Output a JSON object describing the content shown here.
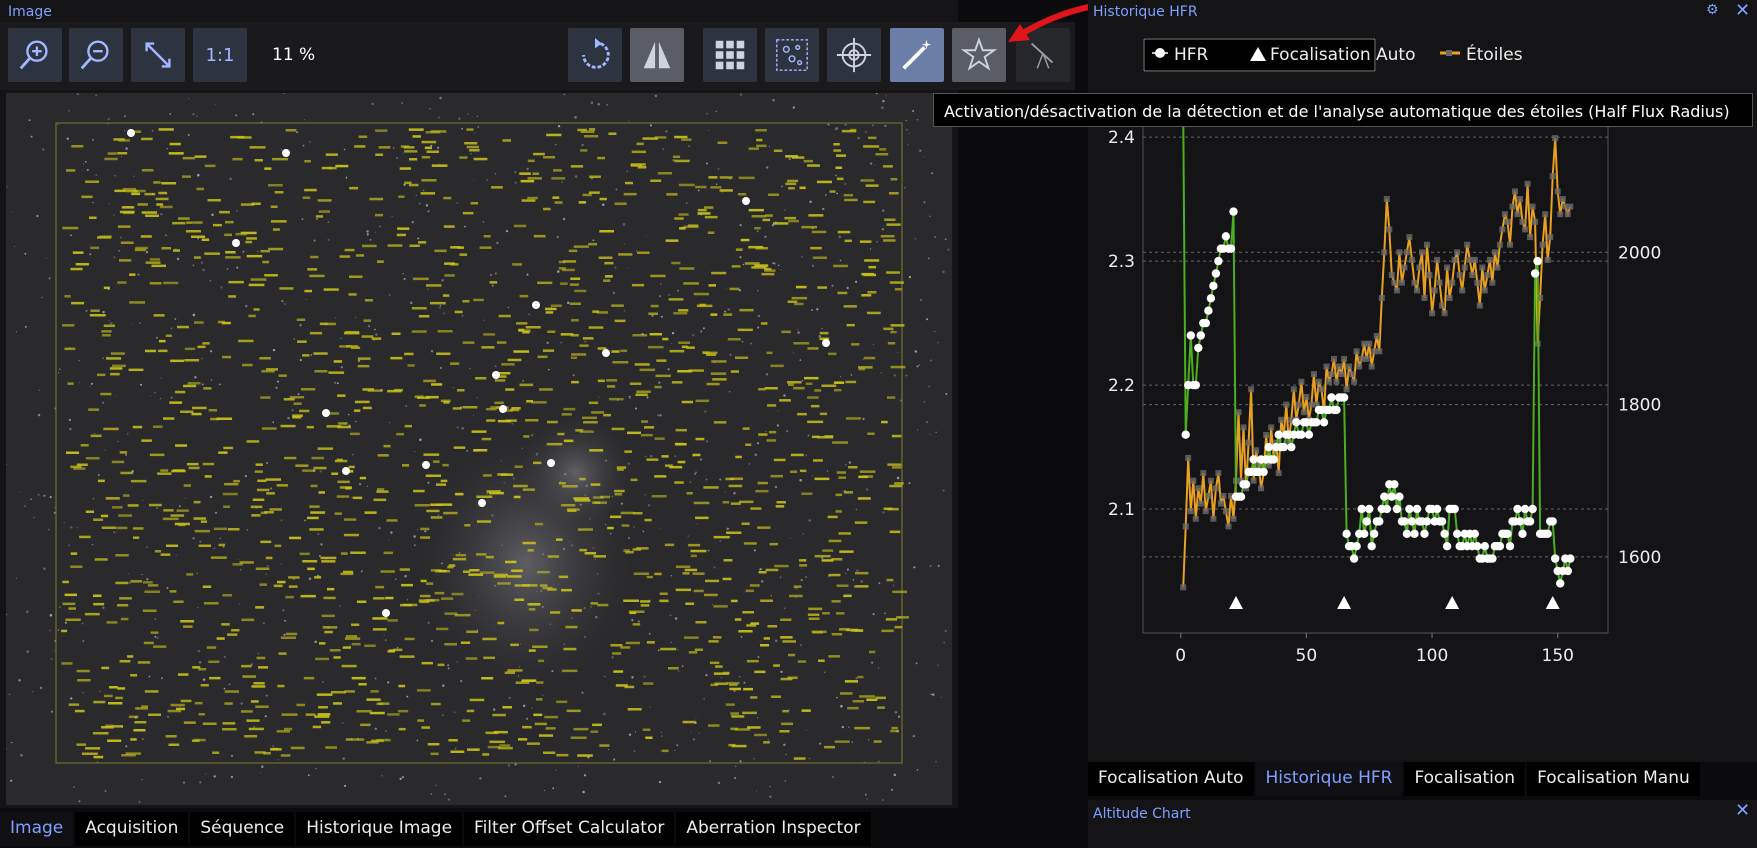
{
  "image_panel": {
    "title": "Image",
    "zoom_label": "11 %",
    "one_to_one_label": "1:1",
    "toolbar_icons": [
      "zoom-in-icon",
      "zoom-out-icon",
      "fit-icon",
      "one-to-one",
      "rotate-icon",
      "flip-icon",
      "grid-icon",
      "stars-icon",
      "crosshair-icon",
      "magic-wand-icon",
      "star-icon",
      "telescope-icon"
    ]
  },
  "tooltip": "Activation/désactivation de la détection et de l'analyse automatique des étoiles (Half Flux Radius)",
  "left_tabs": [
    "Image",
    "Acquisition",
    "Séquence",
    "Historique Image",
    "Filter Offset Calculator",
    "Aberration Inspector"
  ],
  "hfr_panel": {
    "title": "Historique HFR",
    "legend": [
      "HFR",
      "Focalisation Auto",
      "Étoiles"
    ]
  },
  "right_tabs": [
    "Focalisation Auto",
    "Historique HFR",
    "Focalisation",
    "Focalisation Manu"
  ],
  "altitude_panel": {
    "title": "Altitude Chart"
  },
  "colors": {
    "accent": "#7fa0ff",
    "hfr_line": "#4caf1e",
    "stars_line": "#e8a020",
    "hfr_point": "#ffffff"
  },
  "chart_data": {
    "type": "line",
    "xlim": [
      -15,
      170
    ],
    "x_ticks": [
      0,
      50,
      100,
      150
    ],
    "y_left_lim": [
      2.0,
      2.43
    ],
    "y_left_ticks": [
      "2.1",
      "2.2",
      "2.3",
      "2.4"
    ],
    "y_right_lim": [
      1500,
      2200
    ],
    "y_right_ticks": [
      "1600",
      "1800",
      "2000"
    ],
    "series": [
      {
        "name": "HFR",
        "axis": "left",
        "x": [
          1,
          2,
          3,
          4,
          5,
          6,
          7,
          8,
          9,
          10,
          11,
          12,
          13,
          14,
          15,
          16,
          17,
          18,
          19,
          20,
          21,
          22,
          23,
          24,
          25,
          26,
          27,
          28,
          29,
          30,
          31,
          32,
          33,
          34,
          35,
          36,
          37,
          38,
          39,
          40,
          41,
          42,
          43,
          44,
          45,
          46,
          47,
          48,
          49,
          50,
          51,
          52,
          53,
          54,
          55,
          56,
          57,
          58,
          59,
          60,
          61,
          62,
          63,
          64,
          65,
          66,
          67,
          68,
          69,
          70,
          71,
          72,
          73,
          74,
          75,
          76,
          77,
          78,
          79,
          80,
          81,
          82,
          83,
          84,
          85,
          86,
          87,
          88,
          89,
          90,
          91,
          92,
          93,
          94,
          95,
          96,
          97,
          98,
          99,
          100,
          101,
          102,
          103,
          104,
          105,
          106,
          107,
          108,
          109,
          110,
          111,
          112,
          113,
          114,
          115,
          116,
          117,
          118,
          119,
          120,
          121,
          122,
          123,
          124,
          125,
          126,
          127,
          128,
          129,
          130,
          131,
          132,
          133,
          134,
          135,
          136,
          137,
          138,
          139,
          140,
          141,
          142,
          143,
          144,
          145,
          146,
          147,
          148,
          149,
          150,
          151,
          152,
          153,
          154,
          155
        ],
        "values": [
          2.42,
          2.16,
          2.2,
          2.24,
          2.2,
          2.2,
          2.23,
          2.24,
          2.25,
          2.25,
          2.26,
          2.27,
          2.28,
          2.29,
          2.3,
          2.31,
          2.31,
          2.32,
          2.31,
          2.31,
          2.34,
          2.11,
          2.11,
          2.11,
          2.12,
          2.12,
          2.13,
          2.13,
          2.14,
          2.13,
          2.13,
          2.14,
          2.13,
          2.14,
          2.15,
          2.14,
          2.14,
          2.15,
          2.16,
          2.15,
          2.15,
          2.16,
          2.16,
          2.15,
          2.16,
          2.17,
          2.16,
          2.16,
          2.17,
          2.17,
          2.16,
          2.17,
          2.17,
          2.17,
          2.18,
          2.18,
          2.17,
          2.18,
          2.18,
          2.19,
          2.18,
          2.18,
          2.19,
          2.19,
          2.19,
          2.08,
          2.07,
          2.07,
          2.06,
          2.07,
          2.08,
          2.1,
          2.08,
          2.09,
          2.1,
          2.07,
          2.08,
          2.09,
          2.09,
          2.1,
          2.11,
          2.1,
          2.12,
          2.11,
          2.12,
          2.1,
          2.11,
          2.09,
          2.09,
          2.08,
          2.1,
          2.09,
          2.08,
          2.1,
          2.09,
          2.09,
          2.08,
          2.09,
          2.1,
          2.1,
          2.09,
          2.1,
          2.09,
          2.09,
          2.08,
          2.07,
          2.1,
          2.1,
          2.1,
          2.08,
          2.07,
          2.07,
          2.08,
          2.07,
          2.08,
          2.07,
          2.08,
          2.07,
          2.06,
          2.06,
          2.07,
          2.06,
          2.06,
          2.06,
          2.07,
          2.07,
          2.07,
          2.08,
          2.08,
          2.08,
          2.07,
          2.09,
          2.09,
          2.1,
          2.09,
          2.08,
          2.1,
          2.09,
          2.09,
          2.1,
          2.29,
          2.3,
          2.08,
          2.08,
          2.08,
          2.08,
          2.09,
          2.09,
          2.06,
          2.05,
          2.04,
          2.05,
          2.06,
          2.05,
          2.06
        ]
      },
      {
        "name": "Étoiles",
        "axis": "right",
        "x": [
          1,
          2,
          3,
          4,
          5,
          6,
          7,
          8,
          9,
          10,
          11,
          12,
          13,
          14,
          15,
          16,
          17,
          18,
          19,
          20,
          21,
          22,
          23,
          24,
          25,
          26,
          27,
          28,
          29,
          30,
          31,
          32,
          33,
          34,
          35,
          36,
          37,
          38,
          39,
          40,
          41,
          42,
          43,
          44,
          45,
          46,
          47,
          48,
          49,
          50,
          51,
          52,
          53,
          54,
          55,
          56,
          57,
          58,
          59,
          60,
          61,
          62,
          63,
          64,
          65,
          66,
          67,
          68,
          69,
          70,
          71,
          72,
          73,
          74,
          75,
          76,
          77,
          78,
          79,
          80,
          81,
          82,
          83,
          84,
          85,
          86,
          87,
          88,
          89,
          90,
          91,
          92,
          93,
          94,
          95,
          96,
          97,
          98,
          99,
          100,
          101,
          102,
          103,
          104,
          105,
          106,
          107,
          108,
          109,
          110,
          111,
          112,
          113,
          114,
          115,
          116,
          117,
          118,
          119,
          120,
          121,
          122,
          123,
          124,
          125,
          126,
          127,
          128,
          129,
          130,
          131,
          132,
          133,
          134,
          135,
          136,
          137,
          138,
          139,
          140,
          141,
          142,
          143,
          144,
          145,
          146,
          147,
          148,
          149,
          150,
          151,
          152,
          153,
          154,
          155
        ],
        "values": [
          1560,
          1640,
          1730,
          1660,
          1700,
          1650,
          1690,
          1670,
          1710,
          1660,
          1680,
          1700,
          1650,
          1690,
          1710,
          1670,
          1680,
          1660,
          1640,
          1680,
          1650,
          1700,
          1790,
          1700,
          1770,
          1690,
          1750,
          1820,
          1700,
          1740,
          1720,
          1690,
          1710,
          1760,
          1720,
          1770,
          1730,
          1750,
          1710,
          1780,
          1760,
          1800,
          1750,
          1780,
          1820,
          1780,
          1800,
          1830,
          1790,
          1810,
          1780,
          1800,
          1840,
          1800,
          1830,
          1820,
          1790,
          1850,
          1830,
          1840,
          1860,
          1830,
          1850,
          1840,
          1860,
          1820,
          1850,
          1840,
          1830,
          1870,
          1850,
          1860,
          1880,
          1860,
          1880,
          1850,
          1870,
          1890,
          1870,
          1940,
          2000,
          2070,
          2030,
          1970,
          1960,
          1950,
          2000,
          1960,
          1980,
          2000,
          2020,
          1990,
          1960,
          1950,
          1980,
          2000,
          1940,
          2010,
          1970,
          1920,
          1950,
          1990,
          1960,
          1930,
          1920,
          1980,
          1940,
          1960,
          1990,
          2000,
          1970,
          1950,
          1980,
          2010,
          1990,
          1970,
          1990,
          1960,
          1930,
          1980,
          1950,
          1970,
          1990,
          1960,
          2000,
          1980,
          2010,
          2030,
          2050,
          2040,
          2010,
          2060,
          2080,
          2050,
          2070,
          2040,
          2030,
          2090,
          2020,
          2060,
          2040,
          1880,
          1940,
          2010,
          2050,
          1990,
          2020,
          2100,
          2150,
          2080,
          2050,
          2070,
          2060,
          2050,
          2060
        ]
      }
    ],
    "autofocus_markers_x": [
      22,
      65,
      108,
      148
    ]
  }
}
